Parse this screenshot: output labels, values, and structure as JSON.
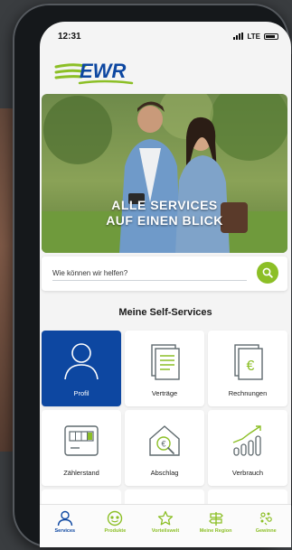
{
  "status_bar": {
    "time": "12:31",
    "network": "LTE"
  },
  "brand": {
    "logo_text": "EWR",
    "primary_color": "#0d47a1",
    "accent_color": "#8cbf26"
  },
  "hero": {
    "line1": "ALLE SERVICES",
    "line2": "AUF EINEN BLICK"
  },
  "search": {
    "placeholder": "Wie können wir helfen?",
    "value": "",
    "icon": "search-icon"
  },
  "section": {
    "title": "Meine Self-Services"
  },
  "tiles": [
    {
      "label": "Profil",
      "icon": "user-icon",
      "active": true
    },
    {
      "label": "Verträge",
      "icon": "document-icon",
      "active": false
    },
    {
      "label": "Rechnungen",
      "icon": "euro-invoice-icon",
      "active": false
    },
    {
      "label": "Zählerstand",
      "icon": "meter-icon",
      "active": false
    },
    {
      "label": "Abschlag",
      "icon": "house-euro-icon",
      "active": false
    },
    {
      "label": "Verbrauch",
      "icon": "bar-chart-icon",
      "active": false
    }
  ],
  "bottom_nav": [
    {
      "label": "Services",
      "icon": "person-icon",
      "active": true
    },
    {
      "label": "Produkte",
      "icon": "products-icon",
      "active": false
    },
    {
      "label": "Vorteilswelt",
      "icon": "star-icon",
      "active": false
    },
    {
      "label": "Meine Region",
      "icon": "signpost-icon",
      "active": false
    },
    {
      "label": "Gewinne",
      "icon": "confetti-icon",
      "active": false
    }
  ]
}
